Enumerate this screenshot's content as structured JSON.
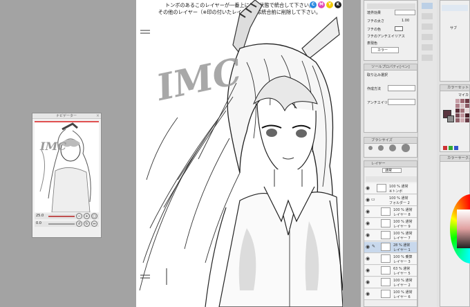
{
  "canvas": {
    "note_line1": "トンボのあるこのレイヤーが一番上にある状態で統合して下さい。",
    "note_line2": "その他のレイヤー（※印の付いたレイヤー）は統合前に削除して下さい。",
    "watermark": "IMC",
    "dot_colors": [
      "#2a8ae0",
      "#e04ab8",
      "#f0c800",
      "#222222"
    ]
  },
  "navigator": {
    "title": "ナビゲーター",
    "zoom": "25.0",
    "angle": "0.0"
  },
  "tool_property": {
    "label_border": "境界効果",
    "label_width": "フチの太さ",
    "width_value": "1.00",
    "label_color": "フチの色",
    "antialias": "フチのアンチエイリアス",
    "label_target": "表現色",
    "target_value": "カラー"
  },
  "subtool": {
    "header": "ツールプロパティ[ペン]",
    "mode_label": "取り込み選択",
    "mode_label2": "作成方法",
    "antialias_label": "アンチエイリ"
  },
  "brush_size": {
    "header": "ブラシサイズ"
  },
  "layers": {
    "header": "レイヤー",
    "blend": "通常",
    "items": [
      {
        "name": "100 % 通常",
        "sub": "※トンボ",
        "selected": false
      },
      {
        "name": "100 % 通常",
        "sub": "フォルダー 2",
        "selected": false
      },
      {
        "name": "100 % 通常",
        "sub": "レイヤー 8",
        "selected": false
      },
      {
        "name": "100 % 通常",
        "sub": "レイヤー 9",
        "selected": false
      },
      {
        "name": "100 % 通常",
        "sub": "レイヤー 7",
        "selected": false
      },
      {
        "name": "28 % 通常",
        "sub": "レイヤー 1",
        "selected": true
      },
      {
        "name": "100 % 乗算",
        "sub": "レイヤー 3",
        "selected": false
      },
      {
        "name": "63 % 通常",
        "sub": "レイヤー 5",
        "selected": false
      },
      {
        "name": "100 % 通常",
        "sub": "レイヤー 2",
        "selected": false
      },
      {
        "name": "100 % 通常",
        "sub": "レイヤー 6",
        "selected": false
      }
    ]
  },
  "color_set": {
    "header": "カラーセット",
    "dropdown": "マイカ"
  },
  "color_wheel": {
    "header": "カラーサークル"
  },
  "sub_tool_top": {
    "header": "サブ"
  }
}
